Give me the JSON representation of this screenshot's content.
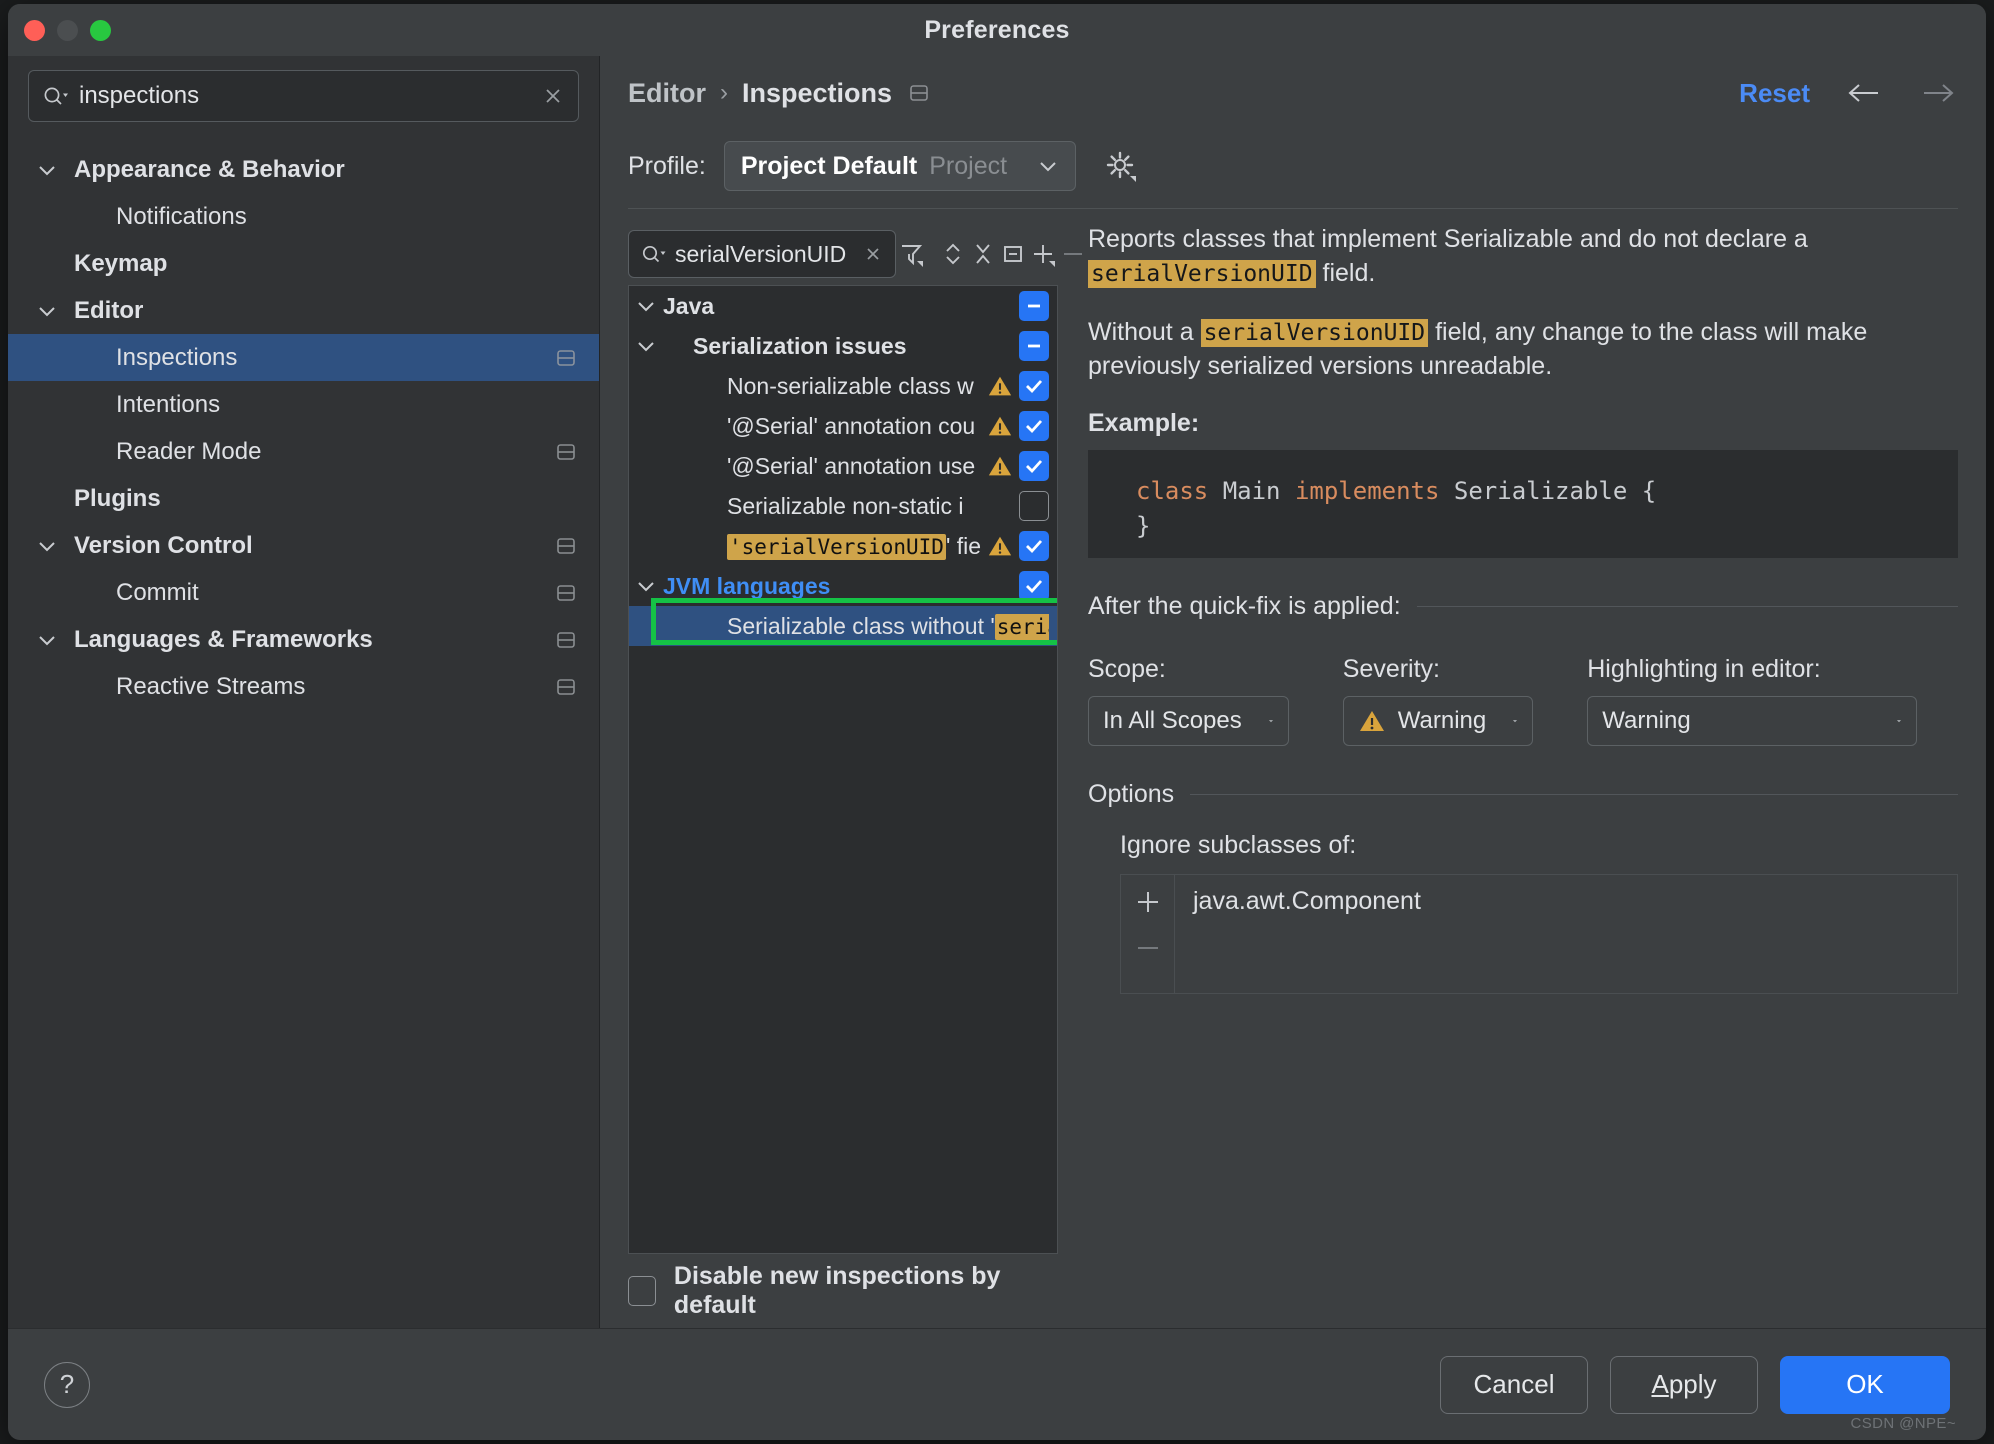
{
  "window": {
    "title": "Preferences"
  },
  "sidebar": {
    "search": {
      "value": "inspections",
      "placeholder": "Search settings",
      "icon": "search-icon",
      "clear_icon": "clear-icon"
    },
    "items": [
      {
        "label": "Appearance & Behavior",
        "level": 0,
        "chevron": "chevron-down",
        "selected": false,
        "badge": false
      },
      {
        "label": "Notifications",
        "level": 1,
        "chevron": "",
        "selected": false,
        "badge": false
      },
      {
        "label": "Keymap",
        "level": 0,
        "chevron": "",
        "selected": false,
        "badge": false
      },
      {
        "label": "Editor",
        "level": 0,
        "chevron": "chevron-down",
        "selected": false,
        "badge": false
      },
      {
        "label": "Inspections",
        "level": 1,
        "chevron": "",
        "selected": true,
        "badge": true
      },
      {
        "label": "Intentions",
        "level": 1,
        "chevron": "",
        "selected": false,
        "badge": false
      },
      {
        "label": "Reader Mode",
        "level": 1,
        "chevron": "",
        "selected": false,
        "badge": true
      },
      {
        "label": "Plugins",
        "level": 0,
        "chevron": "",
        "selected": false,
        "badge": false
      },
      {
        "label": "Version Control",
        "level": 0,
        "chevron": "chevron-down",
        "selected": false,
        "badge": true
      },
      {
        "label": "Commit",
        "level": 1,
        "chevron": "",
        "selected": false,
        "badge": true
      },
      {
        "label": "Languages & Frameworks",
        "level": 0,
        "chevron": "chevron-down",
        "selected": false,
        "badge": true
      },
      {
        "label": "Reactive Streams",
        "level": 1,
        "chevron": "",
        "selected": false,
        "badge": true
      }
    ]
  },
  "header": {
    "breadcrumb": {
      "parent": "Editor",
      "separator": "›",
      "current": "Inspections",
      "badge_icon": "project-scope-icon"
    },
    "reset_label": "Reset",
    "back_icon": "arrow-left-icon",
    "forward_icon": "arrow-right-icon"
  },
  "profile": {
    "label": "Profile:",
    "value": "Project Default",
    "scope": "Project",
    "caret_icon": "chevron-down-icon",
    "gear_icon": "gear-icon"
  },
  "toolbar": {
    "search": {
      "value": "serialVersionUID",
      "placeholder": "Search inspections",
      "icon": "search-icon",
      "clear_icon": "clear-icon"
    },
    "buttons": [
      {
        "name": "filter-icon",
        "title": "Filter"
      },
      {
        "name": "expand-collapse-icon",
        "title": "Expand / Collapse"
      },
      {
        "name": "collapse-all-icon",
        "title": "Collapse All"
      },
      {
        "name": "group-by-icon",
        "title": "Group By"
      },
      {
        "name": "add-icon",
        "title": "Add"
      },
      {
        "name": "remove-icon",
        "title": "Remove"
      }
    ]
  },
  "inspection_tree": {
    "rows": [
      {
        "label": "Java",
        "indent": 0,
        "chevron": "chevron-down",
        "warn": false,
        "check": "mixed",
        "selected": false,
        "highlight": null,
        "link": false
      },
      {
        "label": "Serialization issues",
        "indent": 1,
        "chevron": "chevron-down",
        "warn": false,
        "check": "mixed",
        "selected": false,
        "highlight": null,
        "link": false
      },
      {
        "label": "Non-serializable class w",
        "indent": 2,
        "chevron": "",
        "warn": true,
        "check": "on",
        "selected": false,
        "highlight": null,
        "link": false
      },
      {
        "label": "'@Serial' annotation cou",
        "indent": 2,
        "chevron": "",
        "warn": true,
        "check": "on",
        "selected": false,
        "highlight": null,
        "link": false
      },
      {
        "label": "'@Serial' annotation use",
        "indent": 2,
        "chevron": "",
        "warn": true,
        "check": "on",
        "selected": false,
        "highlight": null,
        "link": false
      },
      {
        "label": "Serializable non-static i",
        "indent": 2,
        "chevron": "",
        "warn": false,
        "check": "off",
        "selected": false,
        "highlight": null,
        "link": false
      },
      {
        "label": "' field r",
        "indent": 2,
        "chevron": "",
        "warn": true,
        "check": "on",
        "selected": false,
        "highlight": "'serialVersionUID",
        "link": false
      },
      {
        "label": "JVM languages",
        "indent": 0,
        "chevron": "chevron-down",
        "warn": false,
        "check": "on",
        "selected": false,
        "highlight": null,
        "link": true
      },
      {
        "label": "Serializable class without '",
        "indent": 2,
        "chevron": "",
        "warn": false,
        "check": null,
        "selected": true,
        "highlight": "serialVersionUID",
        "highlight_suffix": "'",
        "link": false,
        "boxed": true
      }
    ],
    "disable_new_label": "Disable new inspections by default",
    "disable_new_checked": false
  },
  "details": {
    "paragraph1_a": "Reports classes that implement Serializable and do not declare a ",
    "paragraph1_code": "serialVersionUID",
    "paragraph1_b": " field.",
    "paragraph2_a": "Without a ",
    "paragraph2_code": "serialVersionUID",
    "paragraph2_b": " field, any change to the class will make previously serialized versions unreadable.",
    "example_label": "Example:",
    "code": {
      "kw1": "class",
      "name": "Main",
      "kw2": "implements",
      "type": "Serializable {",
      "line2": "}"
    },
    "quickfix_section": "After the quick-fix is applied:",
    "scope": {
      "label": "Scope:",
      "value": "In All Scopes",
      "caret_icon": "chevron-down-icon"
    },
    "severity": {
      "label": "Severity:",
      "value": "Warning",
      "icon": "warning-icon",
      "caret_icon": "chevron-down-icon"
    },
    "highlighting": {
      "label": "Highlighting in editor:",
      "value": "Warning",
      "caret_icon": "chevron-down-icon"
    },
    "options_section": "Options",
    "ignore_label": "Ignore subclasses of:",
    "ignore_items": [
      "java.awt.Component"
    ],
    "add_icon": "plus-icon",
    "remove_icon": "minus-icon"
  },
  "footer": {
    "help_icon": "help-icon",
    "help_glyph": "?",
    "cancel_label": "Cancel",
    "apply_label_a": "A",
    "apply_label_b": "pply",
    "ok_label": "OK",
    "watermark": "CSDN @NPE~"
  },
  "colors": {
    "accent": "#2675f5",
    "selection": "#2f5181",
    "link": "#4b8bf5",
    "highlight_bg": "#cfa44a",
    "warning": "#d9a43c",
    "green_box": "#15c246"
  }
}
